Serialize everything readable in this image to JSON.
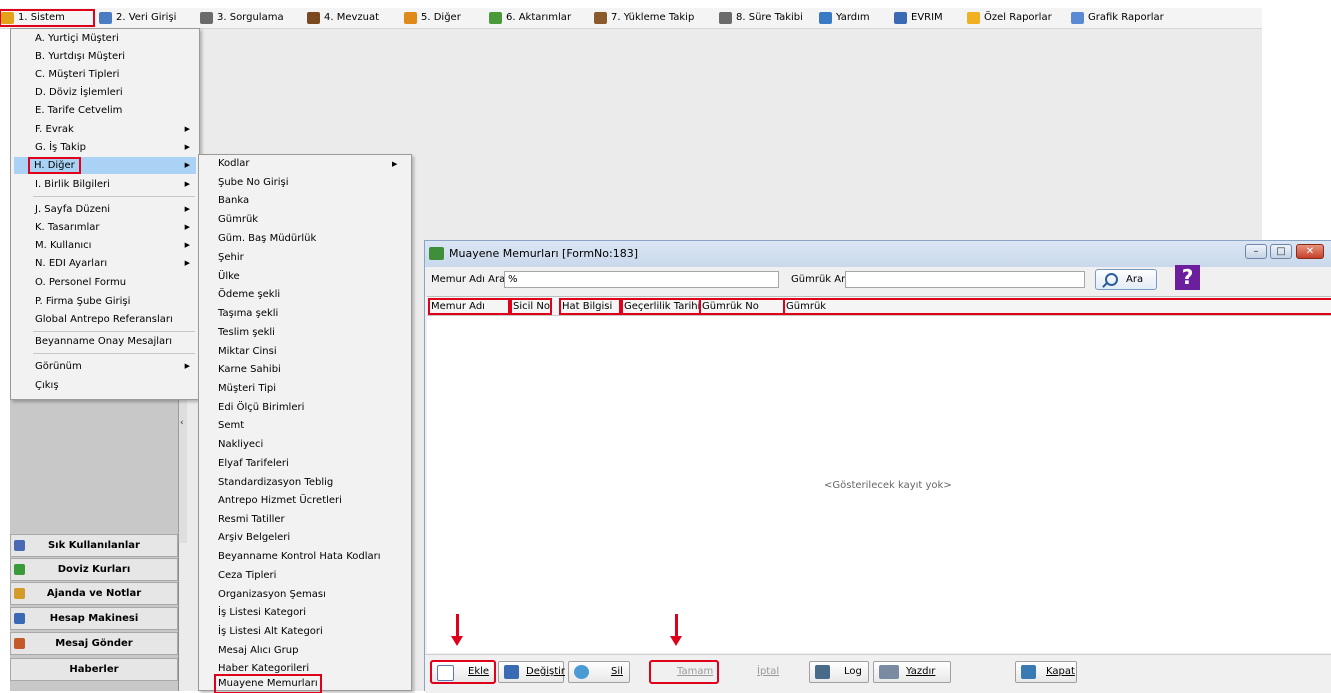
{
  "menubar": {
    "items": [
      {
        "label": "1. Sistem",
        "icon": "folder-icon",
        "color": "#e3a21a"
      },
      {
        "label": "2. Veri Girişi",
        "icon": "edit-icon",
        "color": "#4a7cc4"
      },
      {
        "label": "3. Sorgulama",
        "icon": "query-icon",
        "color": "#6b6b6b"
      },
      {
        "label": "4. Mevzuat",
        "icon": "book-icon",
        "color": "#7a4a1e"
      },
      {
        "label": "5. Diğer",
        "icon": "people-icon",
        "color": "#e08a1a"
      },
      {
        "label": "6. Aktarımlar",
        "icon": "transfer-icon",
        "color": "#4a9a3a"
      },
      {
        "label": "7. Yükleme Takip",
        "icon": "tracking-icon",
        "color": "#8a5a2a"
      },
      {
        "label": "8. Süre Takibi",
        "icon": "calendar-icon",
        "color": "#6b6b6b"
      },
      {
        "label": "Yardım",
        "icon": "help-icon",
        "color": "#3a7ac4"
      },
      {
        "label": "EVRIM",
        "icon": "evrim-icon",
        "color": "#3a6ab4"
      },
      {
        "label": "Özel Raporlar",
        "icon": "star-icon",
        "color": "#f0b020"
      },
      {
        "label": "Grafik Raporlar",
        "icon": "chart-icon",
        "color": "#5a8ad4"
      }
    ]
  },
  "sistem_menu": {
    "items": [
      {
        "label": "A.  Yurtiçi Müşteri",
        "submenu": false
      },
      {
        "label": "B.  Yurtdışı Müşteri",
        "submenu": false
      },
      {
        "label": "C.  Müşteri Tipleri",
        "submenu": false
      },
      {
        "label": "D.  Döviz İşlemleri",
        "submenu": false
      },
      {
        "label": "E.  Tarife Cetvelim",
        "submenu": false
      },
      {
        "label": "F.  Evrak",
        "submenu": true
      },
      {
        "label": "G.  İş Takip",
        "submenu": true
      },
      {
        "label": "H.  Diğer",
        "submenu": true,
        "selected": true
      },
      {
        "label": "I.  Birlik Bilgileri",
        "submenu": true
      },
      {
        "label": "J.  Sayfa Düzeni",
        "submenu": true
      },
      {
        "label": "K.  Tasarımlar",
        "submenu": true
      },
      {
        "label": "M.  Kullanıcı",
        "submenu": true
      },
      {
        "label": "N.  EDI Ayarları",
        "submenu": true
      },
      {
        "label": "O.  Personel Formu",
        "submenu": false
      },
      {
        "label": "P.  Firma Şube Girişi",
        "submenu": false
      },
      {
        "label": "Global Antrepo Referansları",
        "submenu": false
      },
      {
        "label": "Beyanname Onay Mesajları",
        "submenu": false
      },
      {
        "label": "Görünüm",
        "submenu": true
      },
      {
        "label": "Çıkış",
        "submenu": false
      }
    ]
  },
  "diger_submenu": {
    "items": [
      {
        "label": "Kodlar",
        "submenu": true
      },
      {
        "label": "Şube No Girişi"
      },
      {
        "label": "Banka"
      },
      {
        "label": "Gümrük"
      },
      {
        "label": "Güm. Baş Müdürlük"
      },
      {
        "label": "Şehir"
      },
      {
        "label": "Ülke"
      },
      {
        "label": "Ödeme şekli"
      },
      {
        "label": "Taşıma şekli"
      },
      {
        "label": "Teslim şekli"
      },
      {
        "label": "Miktar Cinsi"
      },
      {
        "label": "Karne Sahibi"
      },
      {
        "label": "Müşteri  Tipi"
      },
      {
        "label": "Edi Ölçü Birimleri"
      },
      {
        "label": "Semt"
      },
      {
        "label": "Nakliyeci"
      },
      {
        "label": "Elyaf Tarifeleri"
      },
      {
        "label": "Standardizasyon Teblig"
      },
      {
        "label": "Antrepo Hizmet Ücretleri"
      },
      {
        "label": "Resmi Tatiller"
      },
      {
        "label": "Arşiv Belgeleri"
      },
      {
        "label": "Beyanname Kontrol Hata Kodları"
      },
      {
        "label": "Ceza Tipleri"
      },
      {
        "label": "Organizasyon Şeması"
      },
      {
        "label": "İş Listesi Kategori"
      },
      {
        "label": "İş Listesi Alt Kategori"
      },
      {
        "label": "Mesaj Alıcı Grup"
      },
      {
        "label": "Haber Kategorileri"
      },
      {
        "label": "Muayene Memurları",
        "highlighted": true
      }
    ]
  },
  "left_panel": {
    "buttons": [
      {
        "label": "Sık Kullanılanlar",
        "icon": "favorites-icon",
        "color": "#4a6ab4"
      },
      {
        "label": "Doviz Kurları",
        "icon": "currency-icon",
        "color": "#3a9a3a"
      },
      {
        "label": "Ajanda ve Notlar",
        "icon": "notes-icon",
        "color": "#d49a2a"
      },
      {
        "label": "Hesap Makinesi",
        "icon": "calculator-icon",
        "color": "#3a6ab4"
      },
      {
        "label": "Mesaj Gönder",
        "icon": "message-icon",
        "color": "#c45a2a"
      },
      {
        "label": "Haberler",
        "icon": "",
        "color": ""
      }
    ]
  },
  "form": {
    "title": "Muayene Memurları [FormNo:183]",
    "memur_label": "Memur Adı Ara",
    "memur_value": "%",
    "gumruk_label": "Gümrük Ara",
    "gumruk_value": "",
    "search_label": "Ara",
    "help_glyph": "?",
    "columns": [
      "Memur Adı",
      "Sicil No",
      "Hat Bilgisi",
      "Geçerlilik Tarihi",
      "Gümrük No",
      "Gümrük"
    ],
    "empty_text": "<Gösterilecek kayıt yok>",
    "toolbar": {
      "ekle": "Ekle",
      "degistir": "Değiştir",
      "sil": "Sil",
      "tamam": "Tamam",
      "iptal": "İptal",
      "log": "Log",
      "yazdir": "Yazdır",
      "kapat": "Kapat"
    }
  },
  "colors": {
    "highlight": "#e0001a",
    "menu_selection": "#a9d2f5"
  }
}
